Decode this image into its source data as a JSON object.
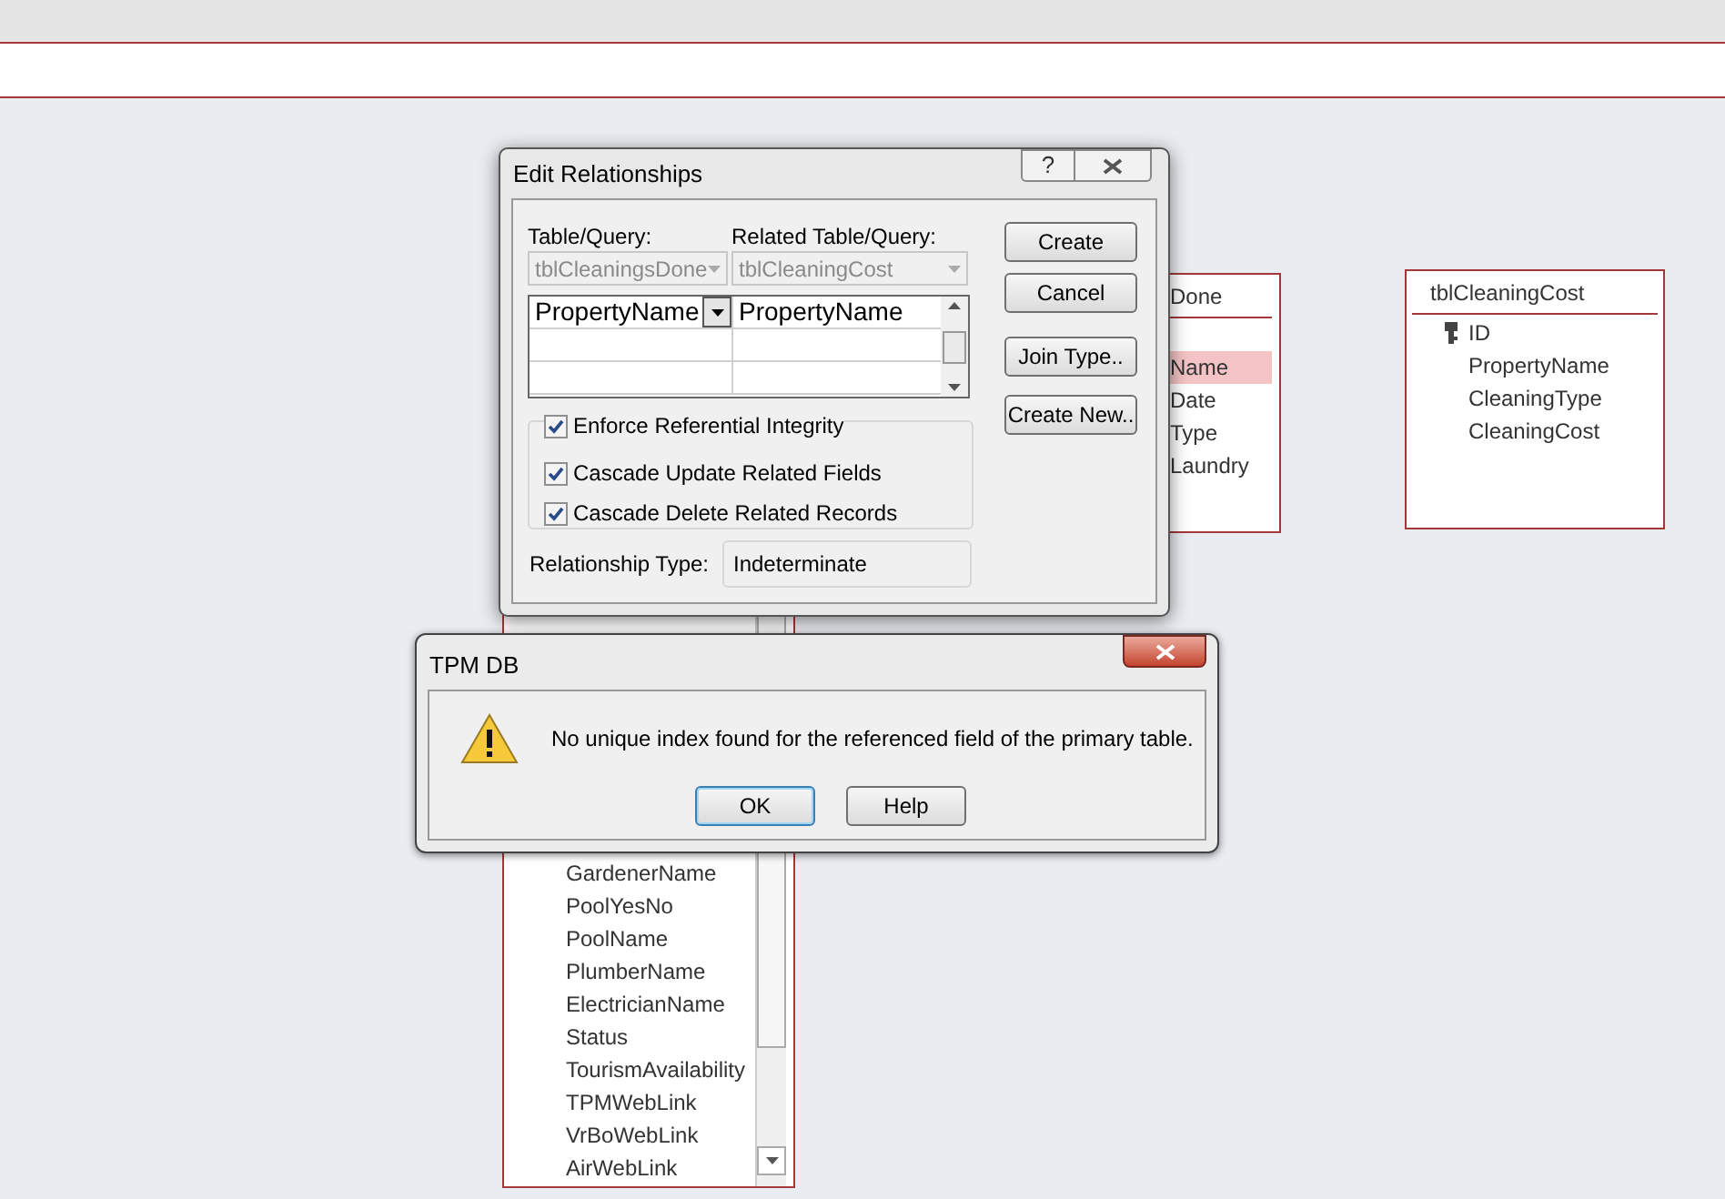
{
  "tables": [
    {
      "title": "tblCleaningCost",
      "fields": [
        {
          "name": "ID",
          "key": true,
          "selected": false
        },
        {
          "name": "PropertyName",
          "key": false,
          "selected": false
        },
        {
          "name": "CleaningType",
          "key": false,
          "selected": false
        },
        {
          "name": "CleaningCost",
          "key": false,
          "selected": false
        }
      ]
    }
  ],
  "partial_table": {
    "title": "Done",
    "fields": [
      {
        "name": "Name",
        "selected": true
      },
      {
        "name": "Date",
        "selected": false
      },
      {
        "name": "Type",
        "selected": false
      },
      {
        "name": "Laundry",
        "selected": false
      }
    ]
  },
  "long_table": {
    "fields": [
      "GardenerName",
      "PoolYesNo",
      "PoolName",
      "PlumberName",
      "ElectricianName",
      "Status",
      "TourismAvailability",
      "TPMWebLink",
      "VrBoWebLink",
      "AirWebLink"
    ]
  },
  "edit_dialog": {
    "title": "Edit Relationships",
    "help": "?",
    "table_label": "Table/Query:",
    "related_label": "Related Table/Query:",
    "table": {
      "value": "tblCleaningsDone",
      "disabled": true
    },
    "related_table": {
      "value": "tblCleaningCost",
      "disabled": true
    },
    "rows": [
      {
        "left": "PropertyName",
        "right": "PropertyName"
      }
    ],
    "options": [
      {
        "label": "Enforce Referential Integrity",
        "checked": true
      },
      {
        "label": "Cascade Update Related Fields",
        "checked": true
      },
      {
        "label": "Cascade Delete Related Records",
        "checked": true
      }
    ],
    "type_label": "Relationship Type:",
    "type_value": "Indeterminate",
    "buttons": [
      "Create",
      "Cancel",
      "Join Type..",
      "Create New.."
    ]
  },
  "message_box": {
    "title": "TPM DB",
    "message": "No unique index found for the referenced field of the primary table.",
    "buttons": [
      {
        "label": "OK",
        "default": true
      },
      {
        "label": "Help",
        "default": false
      }
    ]
  }
}
